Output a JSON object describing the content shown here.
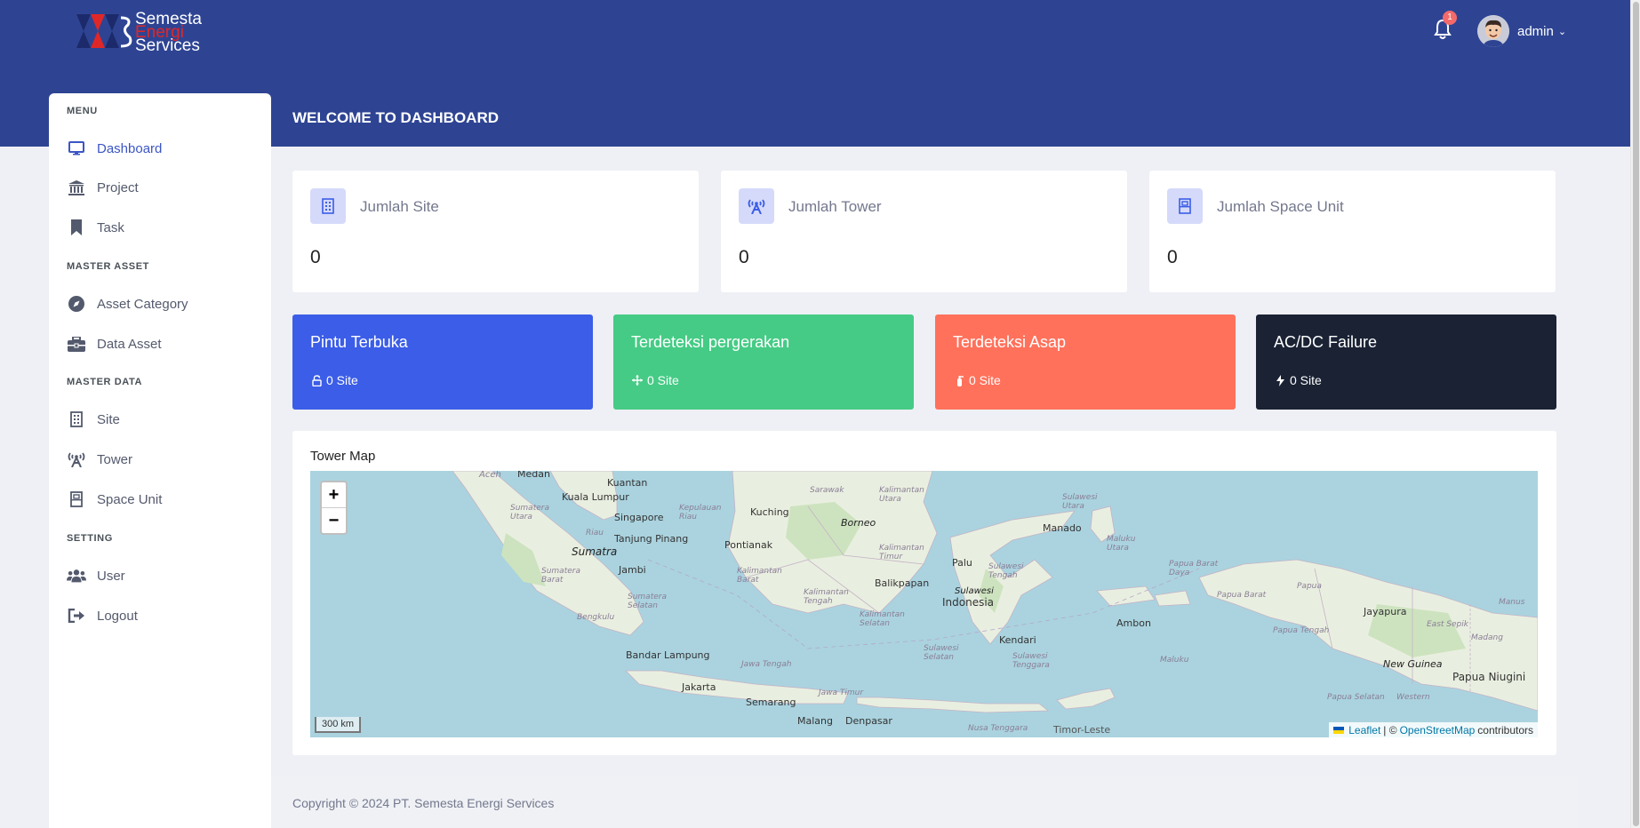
{
  "brand": {
    "line1": "Semesta",
    "line2": "Energi",
    "line3": "Services",
    "colors": {
      "primary": "#2e4493",
      "red": "#e02727"
    }
  },
  "header": {
    "notification_count": "1",
    "user_name": "admin"
  },
  "sidebar": {
    "sections": [
      {
        "title": "MENU",
        "items": [
          {
            "label": "Dashboard",
            "icon": "monitor-icon",
            "active": true
          },
          {
            "label": "Project",
            "icon": "bank-icon"
          },
          {
            "label": "Task",
            "icon": "bookmark-icon"
          }
        ]
      },
      {
        "title": "MASTER ASSET",
        "items": [
          {
            "label": "Asset Category",
            "icon": "compass-icon"
          },
          {
            "label": "Data Asset",
            "icon": "briefcase-icon"
          }
        ]
      },
      {
        "title": "MASTER DATA",
        "items": [
          {
            "label": "Site",
            "icon": "building-icon"
          },
          {
            "label": "Tower",
            "icon": "broadcast-tower-icon"
          },
          {
            "label": "Space Unit",
            "icon": "cabinet-icon"
          }
        ]
      },
      {
        "title": "SETTING",
        "items": [
          {
            "label": "User",
            "icon": "users-icon"
          },
          {
            "label": "Logout",
            "icon": "logout-icon"
          }
        ]
      }
    ]
  },
  "page": {
    "title": "WELCOME TO DASHBOARD"
  },
  "stats": [
    {
      "label": "Jumlah Site",
      "value": "0",
      "icon": "building-icon"
    },
    {
      "label": "Jumlah Tower",
      "value": "0",
      "icon": "broadcast-tower-icon"
    },
    {
      "label": "Jumlah Space Unit",
      "value": "0",
      "icon": "cabinet-icon"
    }
  ],
  "alerts": [
    {
      "title": "Pintu Terbuka",
      "sub": "0 Site",
      "icon": "lock-open-icon",
      "color": "#3b5de7"
    },
    {
      "title": "Terdeteksi pergerakan",
      "sub": "0 Site",
      "icon": "arrows-move-icon",
      "color": "#45cb85"
    },
    {
      "title": "Terdeteksi Asap",
      "sub": "0 Site",
      "icon": "fire-extinguisher-icon",
      "color": "#ff715b"
    },
    {
      "title": "AC/DC Failure",
      "sub": "0 Site",
      "icon": "bolt-icon",
      "color": "#1a2234"
    }
  ],
  "map": {
    "title": "Tower Map",
    "zoom_in": "+",
    "zoom_out": "−",
    "scale": "300 km",
    "attribution": {
      "leaflet": "Leaflet",
      "sep": "| ©",
      "osm": "OpenStreetMap",
      "suffix": "contributors"
    },
    "labels": {
      "aceh": "Aceh",
      "medan": "Medan",
      "kuantan": "Kuantan",
      "kuala_lumpur": "Kuala Lumpur",
      "sumatera_utara": "Sumatera Utara",
      "singapore": "Singapore",
      "kepulauan_riau": "Kepulauan Riau",
      "riau": "Riau",
      "tanjung_pinang": "Tanjung Pinang",
      "sumatra": "Sumatra",
      "jambi": "Jambi",
      "sumatera_barat": "Sumatera Barat",
      "bengkulu": "Bengkulu",
      "sumatera_selatan": "Sumatera Selatan",
      "bandar_lampung": "Bandar Lampung",
      "jakarta": "Jakarta",
      "jawa_tengah": "Jawa Tengah",
      "jawa_timur": "Jawa Timur",
      "semarang": "Semarang",
      "malang": "Malang",
      "denpasar": "Denpasar",
      "nusa_tenggara": "Nusa Tenggara",
      "timor_leste": "Timor-Leste",
      "sarawak": "Sarawak",
      "kuching": "Kuching",
      "borneo": "Borneo",
      "pontianak": "Pontianak",
      "kalimantan_utara": "Kalimantan Utara",
      "kalimantan_timur": "Kalimantan Timur",
      "kalimantan_barat": "Kalimantan Barat",
      "kalimantan_tengah": "Kalimantan Tengah",
      "kalimantan_selatan": "Kalimantan Selatan",
      "balikpapan": "Balikpapan",
      "palu": "Palu",
      "sulawesi": "Sulawesi",
      "indonesia": "Indonesia",
      "sulawesi_tengah": "Sulawesi Tengah",
      "sulawesi_utara": "Sulawesi Utara",
      "manado": "Manado",
      "sulawesi_selatan": "Sulawesi Selatan",
      "sulawesi_tenggara": "Sulawesi Tenggara",
      "kendari": "Kendari",
      "maluku_utara": "Maluku Utara",
      "maluku": "Maluku",
      "ambon": "Ambon",
      "papua_barat_daya": "Papua Barat Daya",
      "papua_barat": "Papua Barat",
      "papua": "Papua",
      "papua_tengah": "Papua Tengah",
      "papua_selatan": "Papua Selatan",
      "jayapura": "Jayapura",
      "east_sepik": "East Sepik",
      "madang": "Madang",
      "manus": "Manus",
      "new_guinea": "New Guinea",
      "papua_niugini": "Papua Niugini",
      "western": "Western"
    }
  },
  "footer": {
    "text": "Copyright © 2024 PT. Semesta Energi Services"
  }
}
